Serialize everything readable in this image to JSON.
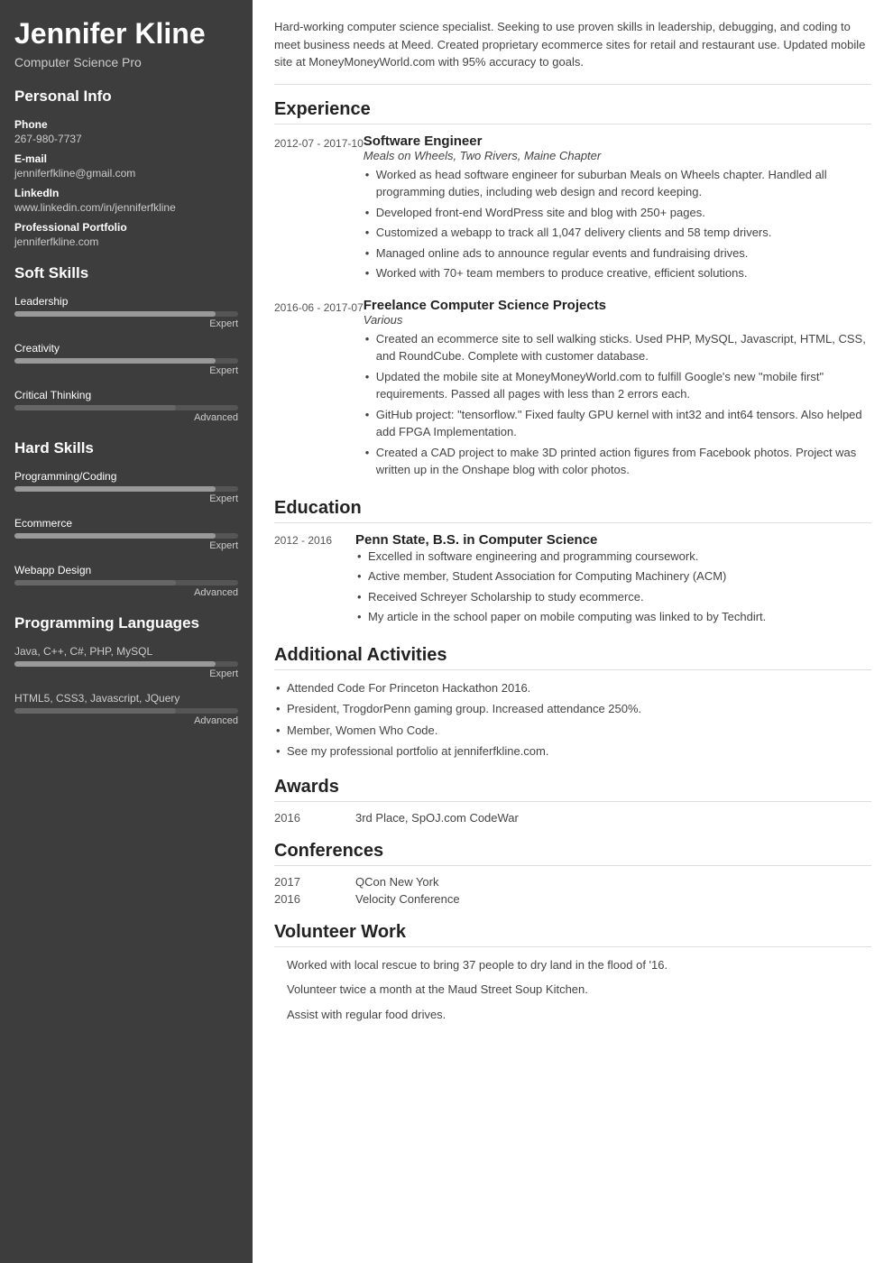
{
  "sidebar": {
    "name": "Jennifer Kline",
    "title": "Computer Science Pro",
    "personal_info_label": "Personal Info",
    "phone_label": "Phone",
    "phone": "267-980-7737",
    "email_label": "E-mail",
    "email": "jenniferfkline@gmail.com",
    "linkedin_label": "LinkedIn",
    "linkedin": "www.linkedin.com/in/jenniferfkline",
    "portfolio_label": "Professional Portfolio",
    "portfolio": "jenniferfkline.com",
    "soft_skills_label": "Soft Skills",
    "soft_skills": [
      {
        "name": "Leadership",
        "level": "Expert",
        "class": "expert"
      },
      {
        "name": "Creativity",
        "level": "Expert",
        "class": "expert"
      },
      {
        "name": "Critical Thinking",
        "level": "Advanced",
        "class": "advanced"
      }
    ],
    "hard_skills_label": "Hard Skills",
    "hard_skills": [
      {
        "name": "Programming/Coding",
        "level": "Expert",
        "class": "expert"
      },
      {
        "name": "Ecommerce",
        "level": "Expert",
        "class": "expert"
      },
      {
        "name": "Webapp Design",
        "level": "Advanced",
        "class": "advanced"
      }
    ],
    "prog_lang_label": "Programming Languages",
    "prog_langs": [
      {
        "name": "Java, C++, C#, PHP, MySQL",
        "level": "Expert",
        "class": "expert"
      },
      {
        "name": "HTML5, CSS3, Javascript, JQuery",
        "level": "Advanced",
        "class": "advanced"
      }
    ]
  },
  "main": {
    "summary": "Hard-working computer science specialist. Seeking to use proven skills in leadership, debugging, and coding to meet business needs at Meed. Created proprietary ecommerce sites for retail and restaurant use. Updated mobile site at MoneyMoneyWorld.com with 95% accuracy to goals.",
    "experience_title": "Experience",
    "experiences": [
      {
        "date": "2012-07 - 2017-10",
        "title": "Software Engineer",
        "org": "Meals on Wheels, Two Rivers, Maine Chapter",
        "bullets": [
          "Worked as head software engineer for suburban Meals on Wheels chapter. Handled all programming duties, including web design and record keeping.",
          "Developed front-end WordPress site and blog with 250+ pages.",
          "Customized a webapp to track all 1,047 delivery clients and 58 temp drivers.",
          "Managed online ads to announce regular events and fundraising drives.",
          "Worked with 70+ team members to produce creative, efficient solutions."
        ]
      },
      {
        "date": "2016-06 - 2017-07",
        "title": "Freelance Computer Science Projects",
        "org": "Various",
        "bullets": [
          "Created an ecommerce site to sell walking sticks. Used PHP, MySQL, Javascript, HTML, CSS, and RoundCube. Complete with customer database.",
          "Updated the mobile site at MoneyMoneyWorld.com to fulfill Google's new \"mobile first\" requirements. Passed all pages with less than 2 errors each.",
          "GitHub project: \"tensorflow.\" Fixed faulty GPU kernel with int32 and int64 tensors. Also helped add FPGA Implementation.",
          "Created a CAD project to make 3D printed action figures from Facebook photos. Project was written up in the Onshape blog with color photos."
        ]
      }
    ],
    "education_title": "Education",
    "educations": [
      {
        "date": "2012 - 2016",
        "school": "Penn State, B.S. in Computer Science",
        "bullets": [
          "Excelled in software engineering and programming coursework.",
          "Active member, Student Association for Computing Machinery (ACM)",
          "Received Schreyer Scholarship to study ecommerce.",
          "My article in the school paper on mobile computing was linked to by Techdirt."
        ]
      }
    ],
    "activities_title": "Additional Activities",
    "activities": [
      "Attended Code For Princeton Hackathon 2016.",
      "President, TrogdorPenn gaming group. Increased attendance 250%.",
      "Member, Women Who Code.",
      "See my professional portfolio at jenniferfkline.com."
    ],
    "awards_title": "Awards",
    "awards": [
      {
        "year": "2016",
        "value": "3rd Place, SpOJ.com CodeWar"
      }
    ],
    "conferences_title": "Conferences",
    "conferences": [
      {
        "year": "2017",
        "value": "QCon New York"
      },
      {
        "year": "2016",
        "value": "Velocity Conference"
      }
    ],
    "volunteer_title": "Volunteer Work",
    "volunteer": [
      "Worked with local rescue to bring 37 people to dry land in the flood of '16.",
      "Volunteer twice a month at the Maud Street Soup Kitchen.",
      "Assist with regular food drives."
    ]
  }
}
